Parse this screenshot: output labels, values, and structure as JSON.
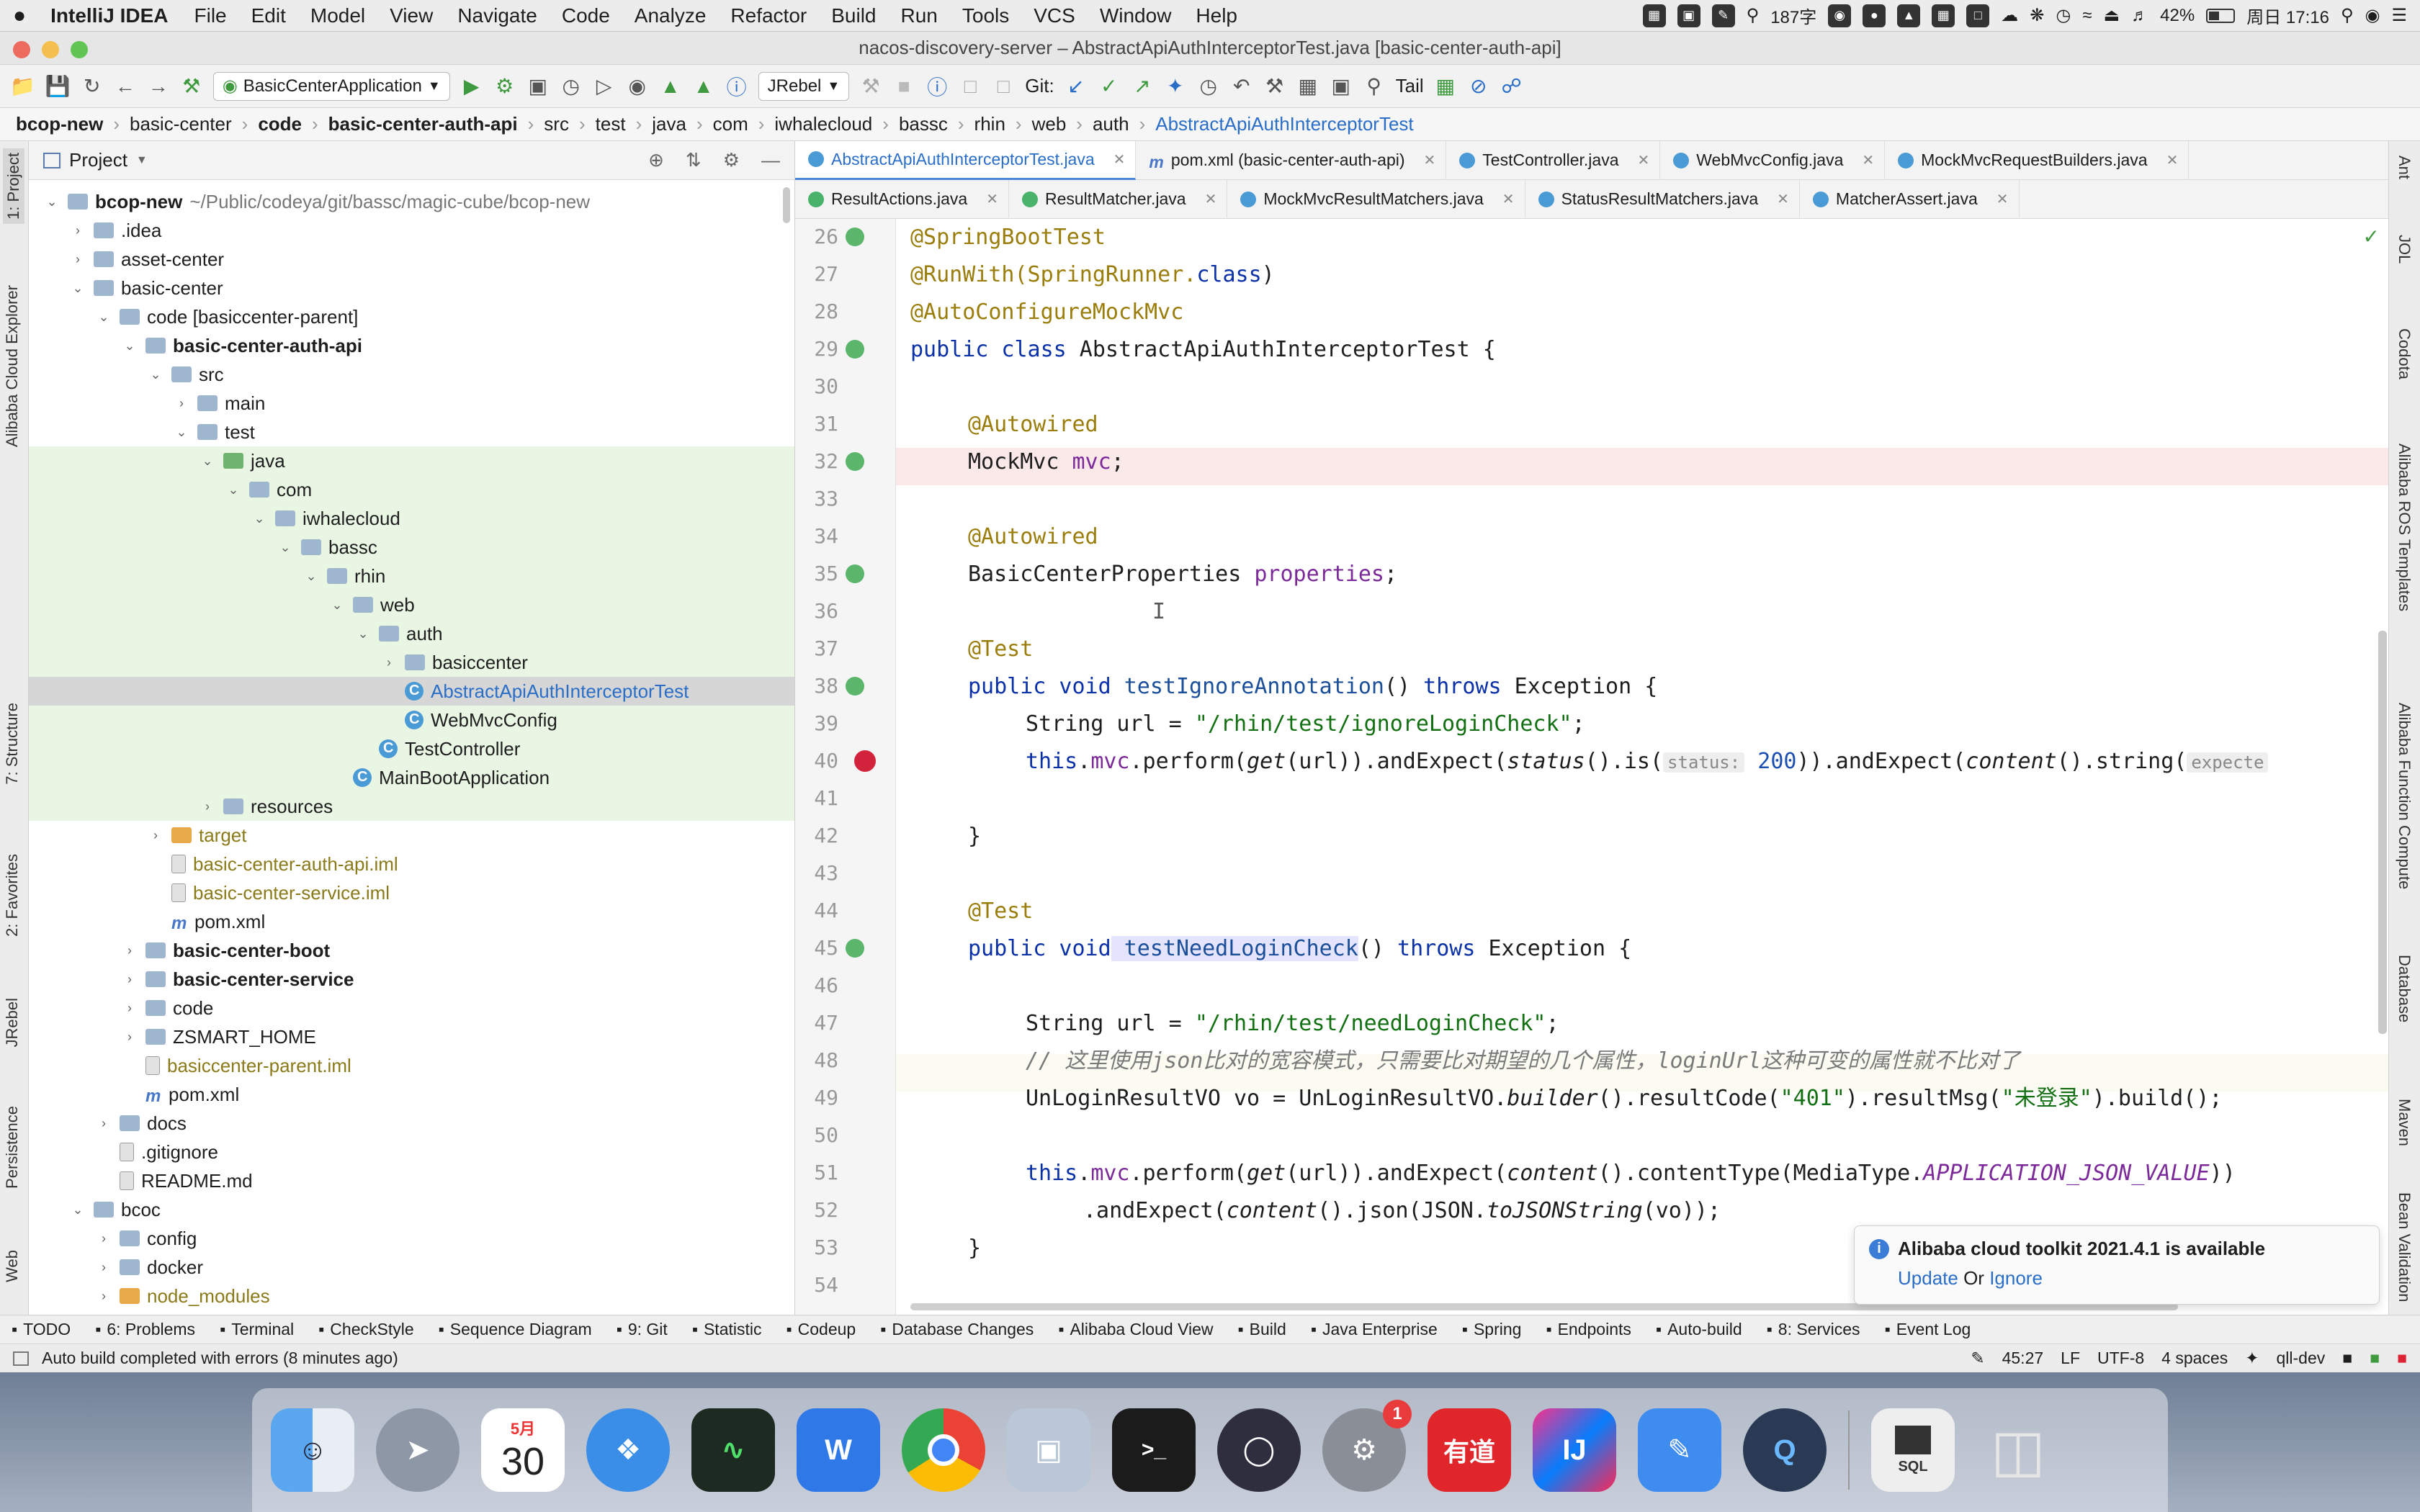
{
  "menubar": {
    "apple": "",
    "app": "IntelliJ IDEA",
    "items": [
      "File",
      "Edit",
      "Model",
      "View",
      "Navigate",
      "Code",
      "Analyze",
      "Refactor",
      "Build",
      "Run",
      "Tools",
      "VCS",
      "Window",
      "Help"
    ],
    "status": {
      "wechat_count": "187字",
      "battery": "42%",
      "clock": "周日 17:16"
    }
  },
  "window": {
    "title": "nacos-discovery-server – AbstractApiAuthInterceptorTest.java [basic-center-auth-api]"
  },
  "toolbar": {
    "run_config": "BasicCenterApplication",
    "jrebel": "JRebel",
    "git_label": "Git:",
    "tail": "Tail"
  },
  "breadcrumb": [
    "bcop-new",
    "basic-center",
    "code",
    "basic-center-auth-api",
    "src",
    "test",
    "java",
    "com",
    "iwhalecloud",
    "bassc",
    "rhin",
    "web",
    "auth",
    "AbstractApiAuthInterceptorTest"
  ],
  "left_strip": [
    "1: Project",
    "Alibaba Cloud Explorer",
    "7: Structure",
    "2: Favorites",
    "JRebel",
    "Persistence",
    "Web"
  ],
  "right_strip": [
    "Ant",
    "JOL",
    "Codota",
    "Alibaba ROS Templates",
    "Alibaba Function Compute",
    "Database",
    "Maven",
    "Bean Validation"
  ],
  "project": {
    "title": "Project",
    "tree": [
      {
        "label": "bcop-new",
        "extra": "~/Public/codeya/git/bassc/magic-cube/bcop-new",
        "depth": 0,
        "tw": "v",
        "icon": "folder",
        "bold": true
      },
      {
        "label": ".idea",
        "depth": 1,
        "tw": ">",
        "icon": "folder"
      },
      {
        "label": "asset-center",
        "depth": 1,
        "tw": ">",
        "icon": "folder"
      },
      {
        "label": "basic-center",
        "depth": 1,
        "tw": "v",
        "icon": "folder"
      },
      {
        "label": "code [basiccenter-parent]",
        "depth": 2,
        "tw": "v",
        "icon": "folder"
      },
      {
        "label": "basic-center-auth-api",
        "depth": 3,
        "tw": "v",
        "icon": "folder",
        "bold": true
      },
      {
        "label": "src",
        "depth": 4,
        "tw": "v",
        "icon": "folder"
      },
      {
        "label": "main",
        "depth": 5,
        "tw": ">",
        "icon": "folder"
      },
      {
        "label": "test",
        "depth": 5,
        "tw": "v",
        "icon": "folder"
      },
      {
        "label": "java",
        "depth": 6,
        "tw": "v",
        "icon": "folder test",
        "green": true
      },
      {
        "label": "com",
        "depth": 7,
        "tw": "v",
        "icon": "folder",
        "green": true
      },
      {
        "label": "iwhalecloud",
        "depth": 8,
        "tw": "v",
        "icon": "folder",
        "green": true
      },
      {
        "label": "bassc",
        "depth": 9,
        "tw": "v",
        "icon": "folder",
        "green": true
      },
      {
        "label": "rhin",
        "depth": 10,
        "tw": "v",
        "icon": "folder",
        "green": true
      },
      {
        "label": "web",
        "depth": 11,
        "tw": "v",
        "icon": "folder",
        "green": true
      },
      {
        "label": "auth",
        "depth": 12,
        "tw": "v",
        "icon": "folder",
        "green": true
      },
      {
        "label": "basiccenter",
        "depth": 13,
        "tw": ">",
        "icon": "folder",
        "green": true
      },
      {
        "label": "AbstractApiAuthInterceptorTest",
        "depth": 13,
        "tw": "",
        "icon": "cls",
        "sel": true,
        "color": "blue"
      },
      {
        "label": "WebMvcConfig",
        "depth": 13,
        "tw": "",
        "icon": "cls",
        "green": true
      },
      {
        "label": "TestController",
        "depth": 12,
        "tw": "",
        "icon": "cls",
        "green": true
      },
      {
        "label": "MainBootApplication",
        "depth": 11,
        "tw": "",
        "icon": "cls",
        "green": true
      },
      {
        "label": "resources",
        "depth": 6,
        "tw": ">",
        "icon": "folder",
        "green": true
      },
      {
        "label": "target",
        "depth": 4,
        "tw": ">",
        "icon": "folder orange",
        "color": "olive"
      },
      {
        "label": "basic-center-auth-api.iml",
        "depth": 4,
        "tw": "",
        "icon": "file",
        "color": "olive"
      },
      {
        "label": "basic-center-service.iml",
        "depth": 4,
        "tw": "",
        "icon": "file",
        "color": "olive"
      },
      {
        "label": "pom.xml",
        "depth": 4,
        "tw": "",
        "icon": "mvn"
      },
      {
        "label": "basic-center-boot",
        "depth": 3,
        "tw": ">",
        "icon": "folder",
        "bold": true
      },
      {
        "label": "basic-center-service",
        "depth": 3,
        "tw": ">",
        "icon": "folder",
        "bold": true
      },
      {
        "label": "code",
        "depth": 3,
        "tw": ">",
        "icon": "folder"
      },
      {
        "label": "ZSMART_HOME",
        "depth": 3,
        "tw": ">",
        "icon": "folder"
      },
      {
        "label": "basiccenter-parent.iml",
        "depth": 3,
        "tw": "",
        "icon": "file",
        "color": "olive"
      },
      {
        "label": "pom.xml",
        "depth": 3,
        "tw": "",
        "icon": "mvn"
      },
      {
        "label": "docs",
        "depth": 2,
        "tw": ">",
        "icon": "folder"
      },
      {
        "label": ".gitignore",
        "depth": 2,
        "tw": "",
        "icon": "file"
      },
      {
        "label": "README.md",
        "depth": 2,
        "tw": "",
        "icon": "file"
      },
      {
        "label": "bcoc",
        "depth": 1,
        "tw": "v",
        "icon": "folder"
      },
      {
        "label": "config",
        "depth": 2,
        "tw": ">",
        "icon": "folder"
      },
      {
        "label": "docker",
        "depth": 2,
        "tw": ">",
        "icon": "folder"
      },
      {
        "label": "node_modules",
        "depth": 2,
        "tw": ">",
        "icon": "folder orange",
        "color": "olive"
      }
    ]
  },
  "editor": {
    "tabs_row1": [
      {
        "label": "AbstractApiAuthInterceptorTest.java",
        "icon": "c",
        "active": true
      },
      {
        "label": "pom.xml (basic-center-auth-api)",
        "icon": "m"
      },
      {
        "label": "TestController.java",
        "icon": "c"
      },
      {
        "label": "WebMvcConfig.java",
        "icon": "c"
      },
      {
        "label": "MockMvcRequestBuilders.java",
        "icon": "c"
      }
    ],
    "tabs_row2": [
      {
        "label": "ResultActions.java",
        "icon": "i"
      },
      {
        "label": "ResultMatcher.java",
        "icon": "i"
      },
      {
        "label": "MockMvcResultMatchers.java",
        "icon": "c"
      },
      {
        "label": "StatusResultMatchers.java",
        "icon": "c"
      },
      {
        "label": "MatcherAssert.java",
        "icon": "c"
      }
    ],
    "line_numbers": [
      "26",
      "27",
      "28",
      "29",
      "30",
      "31",
      "32",
      "33",
      "34",
      "35",
      "36",
      "37",
      "38",
      "39",
      "40",
      "41",
      "42",
      "43",
      "44",
      "45",
      "46",
      "47",
      "48",
      "49",
      "50",
      "51",
      "52",
      "53",
      "54"
    ],
    "code": {
      "l26": "@SpringBootTest",
      "l27a": "@RunWith(SpringRunner.",
      "l27b": "class",
      "l27c": ")",
      "l28": "@AutoConfigureMockMvc",
      "l29a": "public class",
      "l29b": " AbstractApiAuthInterceptorTest {",
      "l31": "@Autowired",
      "l32a": "MockMvc ",
      "l32b": "mvc",
      "l32c": ";",
      "l34": "@Autowired",
      "l35a": "BasicCenterProperties ",
      "l35b": "properties",
      "l35c": ";",
      "l37": "@Test",
      "l38a": "public void",
      "l38b": " testIgnoreAnnotation",
      "l38c": "() ",
      "l38d": "throws",
      "l38e": " Exception {",
      "l39a": "String url = ",
      "l39b": "\"/rhin/test/ignoreLoginCheck\"",
      "l39c": ";",
      "l40a": "this",
      "l40b": ".",
      "l40c": "mvc",
      "l40d": ".perform(",
      "l40e": "get",
      "l40f": "(url)).andExpect(",
      "l40g": "status",
      "l40h": "().is(",
      "l40hint": "status:",
      "l40val": "200",
      "l40i": ")).andExpect(",
      "l40j": "content",
      "l40k": "().string(",
      "l40hint2": "expecte",
      "l42": "}",
      "l44": "@Test",
      "l45a": "public void",
      "l45b": " testNeedLoginCheck",
      "l45c": "() ",
      "l45d": "throws",
      "l45e": " Exception {",
      "l47a": "String url = ",
      "l47b": "\"/rhin/test/needLoginCheck\"",
      "l47c": ";",
      "l48": "// 这里使用json比对的宽容模式，只需要比对期望的几个属性，loginUrl这种可变的属性就不比对了",
      "l49a": "UnLoginResultVO vo = UnLoginResultVO.",
      "l49b": "builder",
      "l49c": "().resultCode(",
      "l49d": "\"401\"",
      "l49e": ").resultMsg(",
      "l49f": "\"未登录\"",
      "l49g": ").build();",
      "l51a": "this",
      "l51b": ".",
      "l51c": "mvc",
      "l51d": ".perform(",
      "l51e": "get",
      "l51f": "(url)).andExpect(",
      "l51g": "content",
      "l51h": "().contentType(MediaType.",
      "l51i": "APPLICATION_JSON_VALUE",
      "l51j": "))",
      "l52a": ".andExpect(",
      "l52b": "content",
      "l52c": "().json(JSON.",
      "l52d": "toJSONString",
      "l52e": "(vo));",
      "l53": "}"
    }
  },
  "notification": {
    "title": "Alibaba cloud toolkit 2021.4.1 is available",
    "update": "Update",
    "or": "Or",
    "ignore": "Ignore"
  },
  "tool_windows": [
    "TODO",
    "6: Problems",
    "Terminal",
    "CheckStyle",
    "Sequence Diagram",
    "9: Git",
    "Statistic",
    "Codeup",
    "Database Changes",
    "Alibaba Cloud View",
    "Build",
    "Java Enterprise",
    "Spring",
    "Endpoints",
    "Auto-build",
    "8: Services",
    "Event Log"
  ],
  "status": {
    "message": "Auto build completed with errors (8 minutes ago)",
    "position": "45:27",
    "line_sep": "LF",
    "encoding": "UTF-8",
    "indent": "4 spaces",
    "branch": "qll-dev"
  },
  "dock": {
    "calendar_month": "5月",
    "calendar_day": "30",
    "youdao": "有道",
    "ij": "IJ",
    "sql": "SQL",
    "badge": "1"
  }
}
